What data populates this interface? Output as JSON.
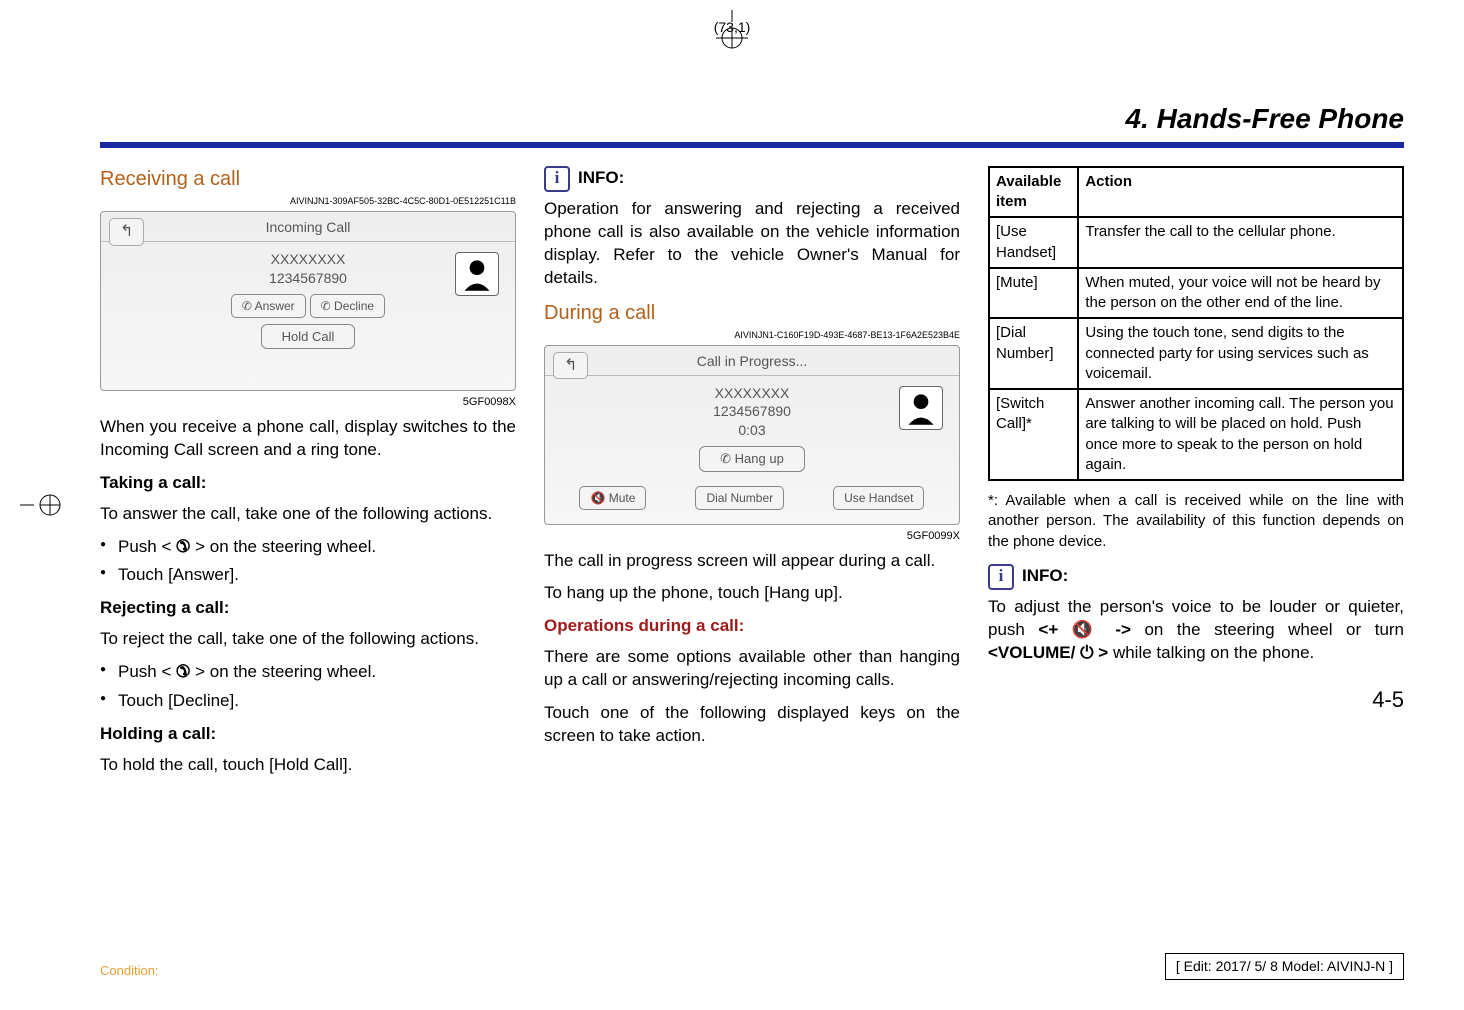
{
  "page_meta": "(73,1)",
  "chapter": "4. Hands-Free Phone",
  "col1": {
    "section1": "Receiving a call",
    "guid1": "AIVINJN1-309AF505-32BC-4C5C-80D1-0E512251C11B",
    "fig1": {
      "title": "Incoming Call",
      "name": "XXXXXXXX",
      "number": "1234567890",
      "answer": "Answer",
      "decline": "Decline",
      "hold": "Hold Call",
      "code": "5GF0098X"
    },
    "para1": "When you receive a phone call, display switches to the Incoming Call screen and a ring tone.",
    "h_taking": "Taking a call:",
    "para2": "To answer the call, take one of the following actions.",
    "bullet1a": "Push < ",
    "bullet1b": " > on the steering wheel.",
    "bullet2": "Touch [Answer].",
    "h_reject": "Rejecting a call:",
    "para3": "To reject the call, take one of the following actions.",
    "bullet3a": "Push < ",
    "bullet3b": " > on the steering wheel.",
    "bullet4": "Touch [Decline].",
    "h_hold": "Holding a call:",
    "para4": "To hold the call, touch [Hold Call]."
  },
  "col2": {
    "info_label": "INFO:",
    "para1": "Operation for answering and rejecting a received phone call is also available on the vehicle information display. Refer to the vehicle Owner's Manual for details.",
    "section2": "During a call",
    "guid2": "AIVINJN1-C160F19D-493E-4687-BE13-1F6A2E523B4E",
    "fig2": {
      "title": "Call in Progress...",
      "name": "XXXXXXXX",
      "number": "1234567890",
      "time": "0:03",
      "hangup": "Hang up",
      "mute": "Mute",
      "dial": "Dial Number",
      "use": "Use Handset",
      "code": "5GF0099X"
    },
    "para2": "The call in progress screen will appear during a call.",
    "para3": "To hang up the phone, touch [Hang up].",
    "sub_ops": "Operations during a call:",
    "para4": "There are some options available other than hanging up a call or answering/rejecting incoming calls.",
    "para5": "Touch one of the following displayed keys on the screen to take action."
  },
  "col3": {
    "th1": "Available item",
    "th2": "Action",
    "r1c1": "[Use Handset]",
    "r1c2": "Transfer the call to the cellular phone.",
    "r2c1": "[Mute]",
    "r2c2": "When muted, your voice will not be heard by the person on the other end of the line.",
    "r3c1": "[Dial Number]",
    "r3c2": "Using the touch tone, send digits to the connected party for using services such as voicemail.",
    "r4c1": "[Switch Call]*",
    "r4c2": "Answer another incoming call. The person you are talking to will be placed on hold. Push once more to speak to the person on hold again.",
    "footnote": "*: Available when a call is received while on the line with another person. The availability of this function depends on the phone device.",
    "info_label": "INFO:",
    "info_text_a": "To adjust the person's voice to be louder or quieter, push ",
    "info_bold1a": "<+ ",
    "info_bold1b": " ->",
    "info_text_b": " on the steering wheel or turn ",
    "info_bold2a": "<VOLUME/ ",
    "info_bold2b": " >",
    "info_text_c": " while talking on the phone."
  },
  "page_number": "4-5",
  "condition": "Condition:",
  "edit_line": "[ Edit: 2017/ 5/ 8   Model: AIVINJ-N ]"
}
